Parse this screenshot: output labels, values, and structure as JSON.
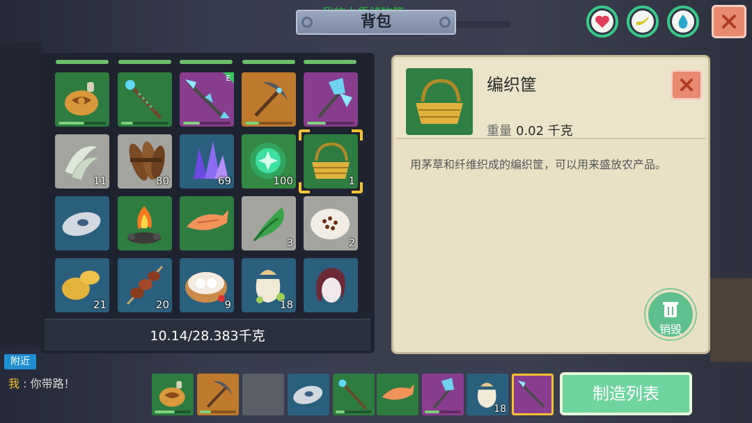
{
  "header": {
    "title": "背包",
    "chest_caption": "我的木质储物箱"
  },
  "status_icons": [
    "heart-icon",
    "stamina-icon",
    "water-drop-icon"
  ],
  "inventory": {
    "weight": "10.14/28.383千克",
    "slots": [
      {
        "icon": "water-flask-icon",
        "color": "green",
        "count": "",
        "durability": 0.55
      },
      {
        "icon": "magic-staff-icon",
        "color": "green",
        "count": "",
        "durability": 0.25
      },
      {
        "icon": "crystal-spear-icon",
        "color": "purple",
        "count": "",
        "badge": "E",
        "durability": 0.35
      },
      {
        "icon": "pickaxe-icon",
        "color": "orange",
        "count": "",
        "durability": 0.3
      },
      {
        "icon": "crystal-axe-icon",
        "color": "purple",
        "count": "",
        "durability": 0.4
      },
      {
        "icon": "grass-fiber-icon",
        "color": "gray",
        "count": "11"
      },
      {
        "icon": "wood-bundle-icon",
        "color": "gray",
        "count": "80"
      },
      {
        "icon": "purple-crystal-icon",
        "color": "blue",
        "count": "69"
      },
      {
        "icon": "green-orb-icon",
        "color": "green",
        "count": "100"
      },
      {
        "icon": "woven-basket-icon",
        "color": "green",
        "count": "1"
      },
      {
        "icon": "stone-disc-icon",
        "color": "blue",
        "count": ""
      },
      {
        "icon": "campfire-icon",
        "color": "green",
        "count": ""
      },
      {
        "icon": "roasted-fish-icon",
        "color": "green",
        "count": ""
      },
      {
        "icon": "green-vegetable-icon",
        "color": "gray",
        "count": "3"
      },
      {
        "icon": "seed-plate-icon",
        "color": "gray",
        "count": "2"
      },
      {
        "icon": "potato-icon",
        "color": "blue",
        "count": "21"
      },
      {
        "icon": "meat-skewer-icon",
        "color": "blue",
        "count": "20"
      },
      {
        "icon": "dumpling-steamer-icon",
        "color": "blue",
        "count": "9"
      },
      {
        "icon": "grain-sack-icon",
        "color": "blue",
        "count": "18"
      },
      {
        "icon": "hair-wig-icon",
        "color": "blue",
        "count": ""
      }
    ]
  },
  "detail": {
    "name": "编织筐",
    "weight_label": "重量",
    "weight_value": "0.02 千克",
    "description": "用茅草和纤维织成的编织筐，可以用来盛放农产品。",
    "destroy_label": "销毁"
  },
  "chat": {
    "tag": "附近",
    "speaker": "我",
    "message": "你带路！"
  },
  "hotbar": {
    "slots": [
      {
        "icon": "water-flask-icon",
        "count": ""
      },
      {
        "icon": "pickaxe-icon",
        "count": ""
      },
      {
        "icon": "empty-slot",
        "count": ""
      },
      {
        "icon": "stone-disc-icon",
        "count": ""
      },
      {
        "icon": "magic-staff-icon",
        "count": ""
      },
      {
        "icon": "roasted-fish-icon",
        "count": ""
      },
      {
        "icon": "crystal-axe-icon",
        "count": ""
      },
      {
        "icon": "grain-sack-icon",
        "count": "18"
      },
      {
        "icon": "crystal-spear-icon",
        "count": ""
      }
    ],
    "craft_label": "制造列表"
  }
}
